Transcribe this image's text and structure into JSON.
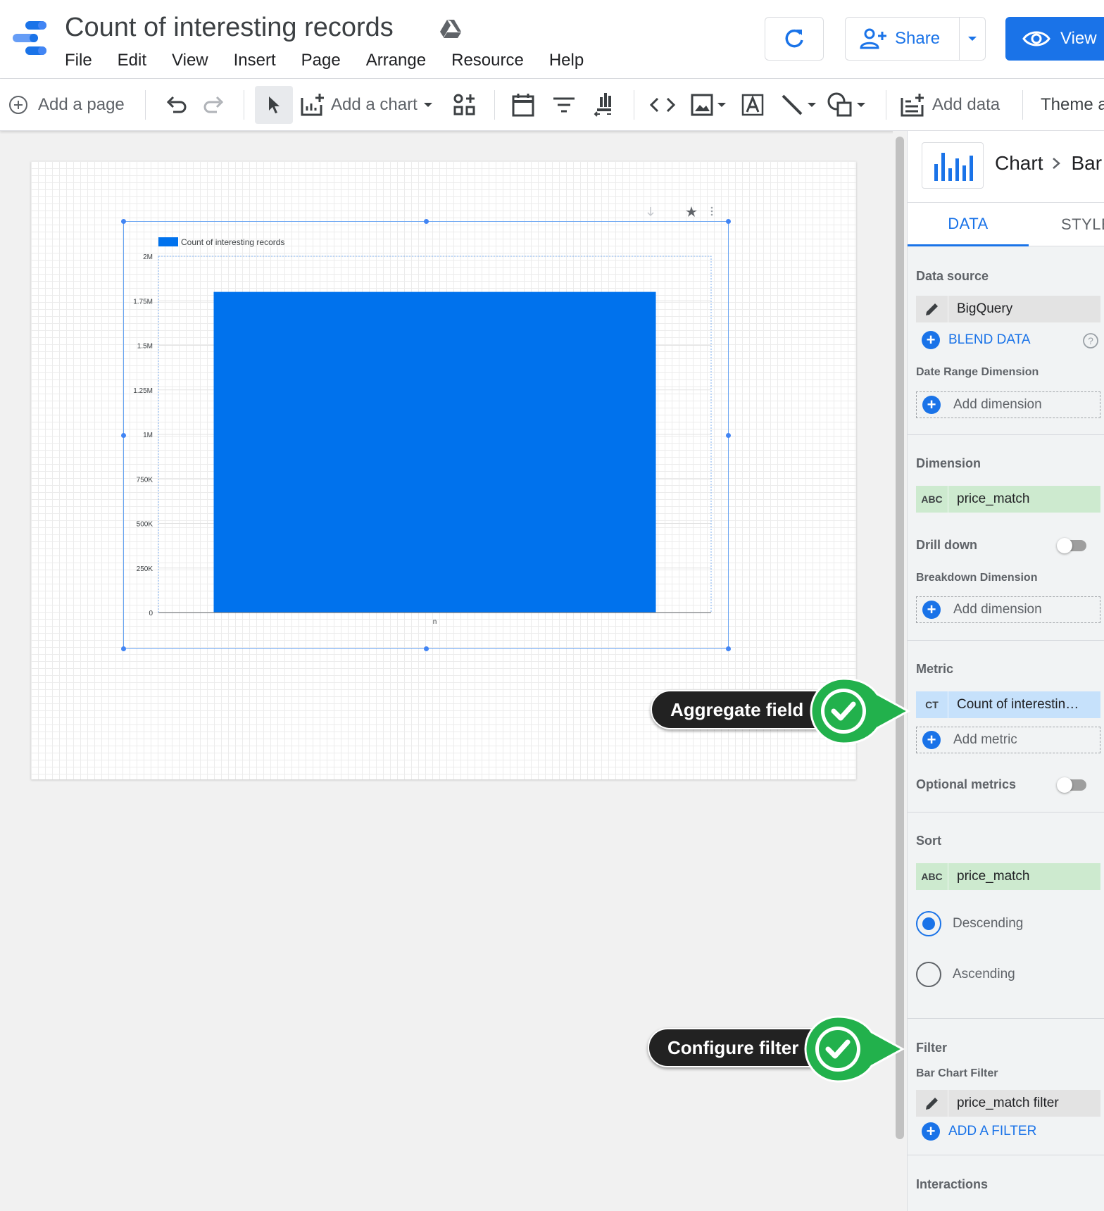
{
  "header": {
    "title": "Count of interesting records",
    "menu": [
      "File",
      "Edit",
      "View",
      "Insert",
      "Page",
      "Arrange",
      "Resource",
      "Help"
    ],
    "share_label": "Share",
    "view_label": "View"
  },
  "toolbar": {
    "add_page": "Add a page",
    "add_chart": "Add a chart",
    "add_data": "Add data",
    "theme": "Theme a"
  },
  "chart_data": {
    "type": "bar",
    "legend": "Count of interesting records",
    "categories": [
      "n"
    ],
    "values": [
      1800000
    ],
    "ylim": [
      0,
      2000000
    ],
    "yticks": [
      0,
      250000,
      500000,
      750000,
      1000000,
      1250000,
      1500000,
      1750000,
      2000000
    ],
    "ytick_labels": [
      "0",
      "250K",
      "500K",
      "750K",
      "1M",
      "1.25M",
      "1.5M",
      "1.75M",
      "2M"
    ],
    "bar_color": "#0072ed",
    "grid": true
  },
  "panel": {
    "breadcrumb_root": "Chart",
    "breadcrumb_child": "Bar",
    "tabs": {
      "data": "DATA",
      "style": "STYLE"
    },
    "data_source_label": "Data source",
    "data_source": "BigQuery",
    "blend_data": "BLEND DATA",
    "date_range_label": "Date Range Dimension",
    "add_dimension": "Add dimension",
    "dimension_label": "Dimension",
    "dimension_badge": "ABC",
    "dimension": "price_match",
    "drill_down": "Drill down",
    "breakdown_label": "Breakdown Dimension",
    "metric_label": "Metric",
    "metric_badge": "CT",
    "metric": "Count of interestin…",
    "add_metric": "Add metric",
    "optional_metrics": "Optional metrics",
    "sort_label": "Sort",
    "sort_field": "price_match",
    "descending": "Descending",
    "ascending": "Ascending",
    "filter_label": "Filter",
    "bar_chart_filter_label": "Bar Chart Filter",
    "filter_name": "price_match filter",
    "add_filter": "ADD A FILTER",
    "interactions_label": "Interactions"
  },
  "callouts": {
    "aggregate": "Aggregate field",
    "filter": "Configure filter"
  },
  "colors": {
    "accent": "#1a73e8",
    "callout_green": "#22b14c"
  }
}
